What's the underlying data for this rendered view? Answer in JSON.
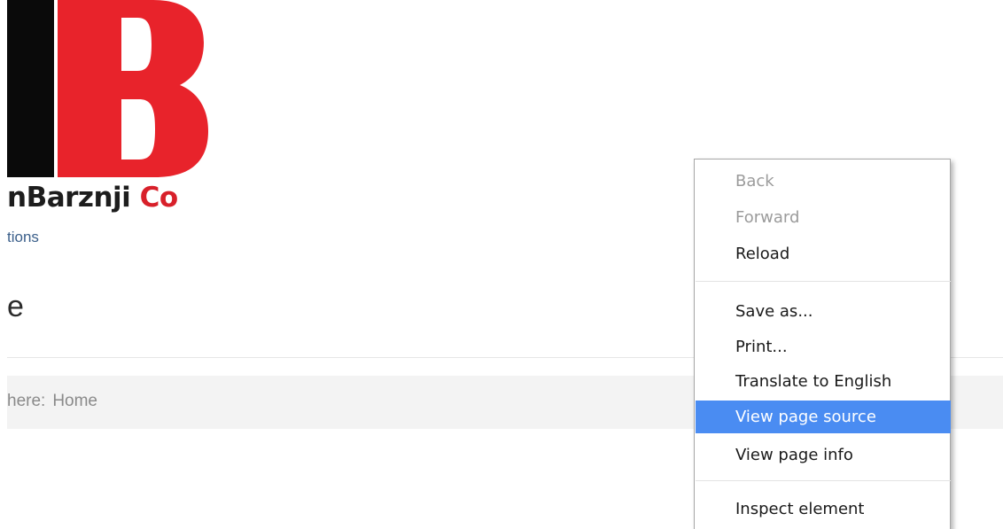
{
  "logo": {
    "name_main": "nBarznji",
    "name_co": "Co",
    "tagline": "tions",
    "colors": {
      "black": "#0a0a0a",
      "red": "#e8232b"
    }
  },
  "page": {
    "heading_fragment": "e",
    "breadcrumb": {
      "prefix": "here:",
      "current": "Home"
    }
  },
  "context_menu": {
    "items": [
      {
        "label": "Back",
        "state": "disabled"
      },
      {
        "label": "Forward",
        "state": "disabled"
      },
      {
        "label": "Reload",
        "state": "enabled"
      },
      {
        "label": "Save as...",
        "state": "enabled"
      },
      {
        "label": "Print...",
        "state": "enabled"
      },
      {
        "label": "Translate to English",
        "state": "enabled"
      },
      {
        "label": "View page source",
        "state": "highlighted"
      },
      {
        "label": "View page info",
        "state": "enabled"
      },
      {
        "label": "Inspect element",
        "state": "enabled"
      }
    ],
    "highlight_color": "#4a8cf2"
  }
}
